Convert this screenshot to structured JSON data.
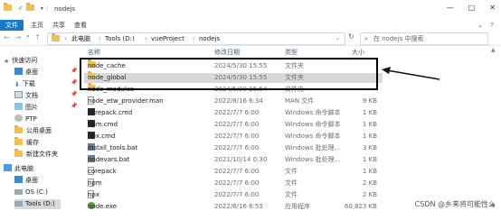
{
  "window": {
    "title": "nodejs",
    "minimize": "—",
    "maximize": "□",
    "close": "✕"
  },
  "ribbon": {
    "tabs": [
      "文件",
      "主页",
      "共享",
      "查看"
    ],
    "help": "?"
  },
  "nav": {
    "back": "←",
    "forward": "→",
    "up": "↑",
    "breadcrumb": [
      "此电脑",
      "Tools (D:)",
      "vueProject",
      "nodejs"
    ],
    "search_placeholder": "在 nodejs 中搜索"
  },
  "sidebar": {
    "items": [
      {
        "label": "快速访问",
        "icon": "star-icon",
        "pinned": false
      },
      {
        "label": "桌面",
        "icon": "desktop-icon",
        "pinned": true
      },
      {
        "label": "下载",
        "icon": "download-icon",
        "pinned": true
      },
      {
        "label": "文档",
        "icon": "document-icon",
        "pinned": true
      },
      {
        "label": "图片",
        "icon": "picture-icon",
        "pinned": true
      },
      {
        "label": "PTP",
        "icon": "disc-icon",
        "pinned": false
      },
      {
        "label": "公用桌面",
        "icon": "folder-icon",
        "pinned": false
      },
      {
        "label": "缓存",
        "icon": "folder-icon",
        "pinned": false
      },
      {
        "label": "新建文件夹",
        "icon": "folder-icon",
        "pinned": false
      },
      {
        "label": "此电脑",
        "icon": "computer-icon",
        "pinned": false
      },
      {
        "label": "桌面",
        "icon": "desktop-icon",
        "pinned": false
      },
      {
        "label": "OS (C:)",
        "icon": "drive-icon",
        "pinned": false
      },
      {
        "label": "Tools (D:)",
        "icon": "drive-icon",
        "pinned": false
      }
    ]
  },
  "table": {
    "headers": {
      "name": "名称",
      "date": "修改日期",
      "type": "类型",
      "size": "大小"
    },
    "rows": [
      {
        "name": "node_cache",
        "date": "2024/5/30 15:55",
        "type": "文件夹",
        "size": "",
        "icon": "folder-icon"
      },
      {
        "name": "node_global",
        "date": "2024/5/30 15:55",
        "type": "文件夹",
        "size": "",
        "icon": "folder-icon"
      },
      {
        "name": "node_modules",
        "date": "2024/5/30 15:54",
        "type": "文件夹",
        "size": "",
        "icon": "folder-icon"
      },
      {
        "name": "node_etw_provider.man",
        "date": "2022/8/16 6:34",
        "type": "MAN 文件",
        "size": "9 KB",
        "icon": "file-icon"
      },
      {
        "name": "corepack.cmd",
        "date": "2022/7/7 6:00",
        "type": "Windows 命令脚本",
        "size": "1 KB",
        "icon": "cmd-icon"
      },
      {
        "name": "npm.cmd",
        "date": "2022/7/7 6:00",
        "type": "Windows 命令脚本",
        "size": "1 KB",
        "icon": "cmd-icon"
      },
      {
        "name": "npx.cmd",
        "date": "2022/7/7 6:00",
        "type": "Windows 命令脚本",
        "size": "1 KB",
        "icon": "cmd-icon"
      },
      {
        "name": "install_tools.bat",
        "date": "2022/7/7 6:00",
        "type": "Windows 批处理...",
        "size": "3 KB",
        "icon": "cmd-icon"
      },
      {
        "name": "nodevars.bat",
        "date": "2021/10/14 0:30",
        "type": "Windows 批处理...",
        "size": "1 KB",
        "icon": "cmd-icon"
      },
      {
        "name": "corepack",
        "date": "2022/7/7 6:00",
        "type": "文件",
        "size": "1 KB",
        "icon": "file-icon"
      },
      {
        "name": "npm",
        "date": "2022/7/7 6:00",
        "type": "文件",
        "size": "2 KB",
        "icon": "file-icon"
      },
      {
        "name": "npx",
        "date": "2022/7/7 6:00",
        "type": "文件",
        "size": "2 KB",
        "icon": "file-icon"
      },
      {
        "name": "node.exe",
        "date": "2022/8/16 6:53",
        "type": "应用程序",
        "size": "60,823 KB",
        "icon": "node-icon"
      }
    ]
  },
  "watermark": "CSDN @乡来将可能性么",
  "colors": {
    "accent": "#1979ca",
    "selection": "#d9d9d9"
  }
}
